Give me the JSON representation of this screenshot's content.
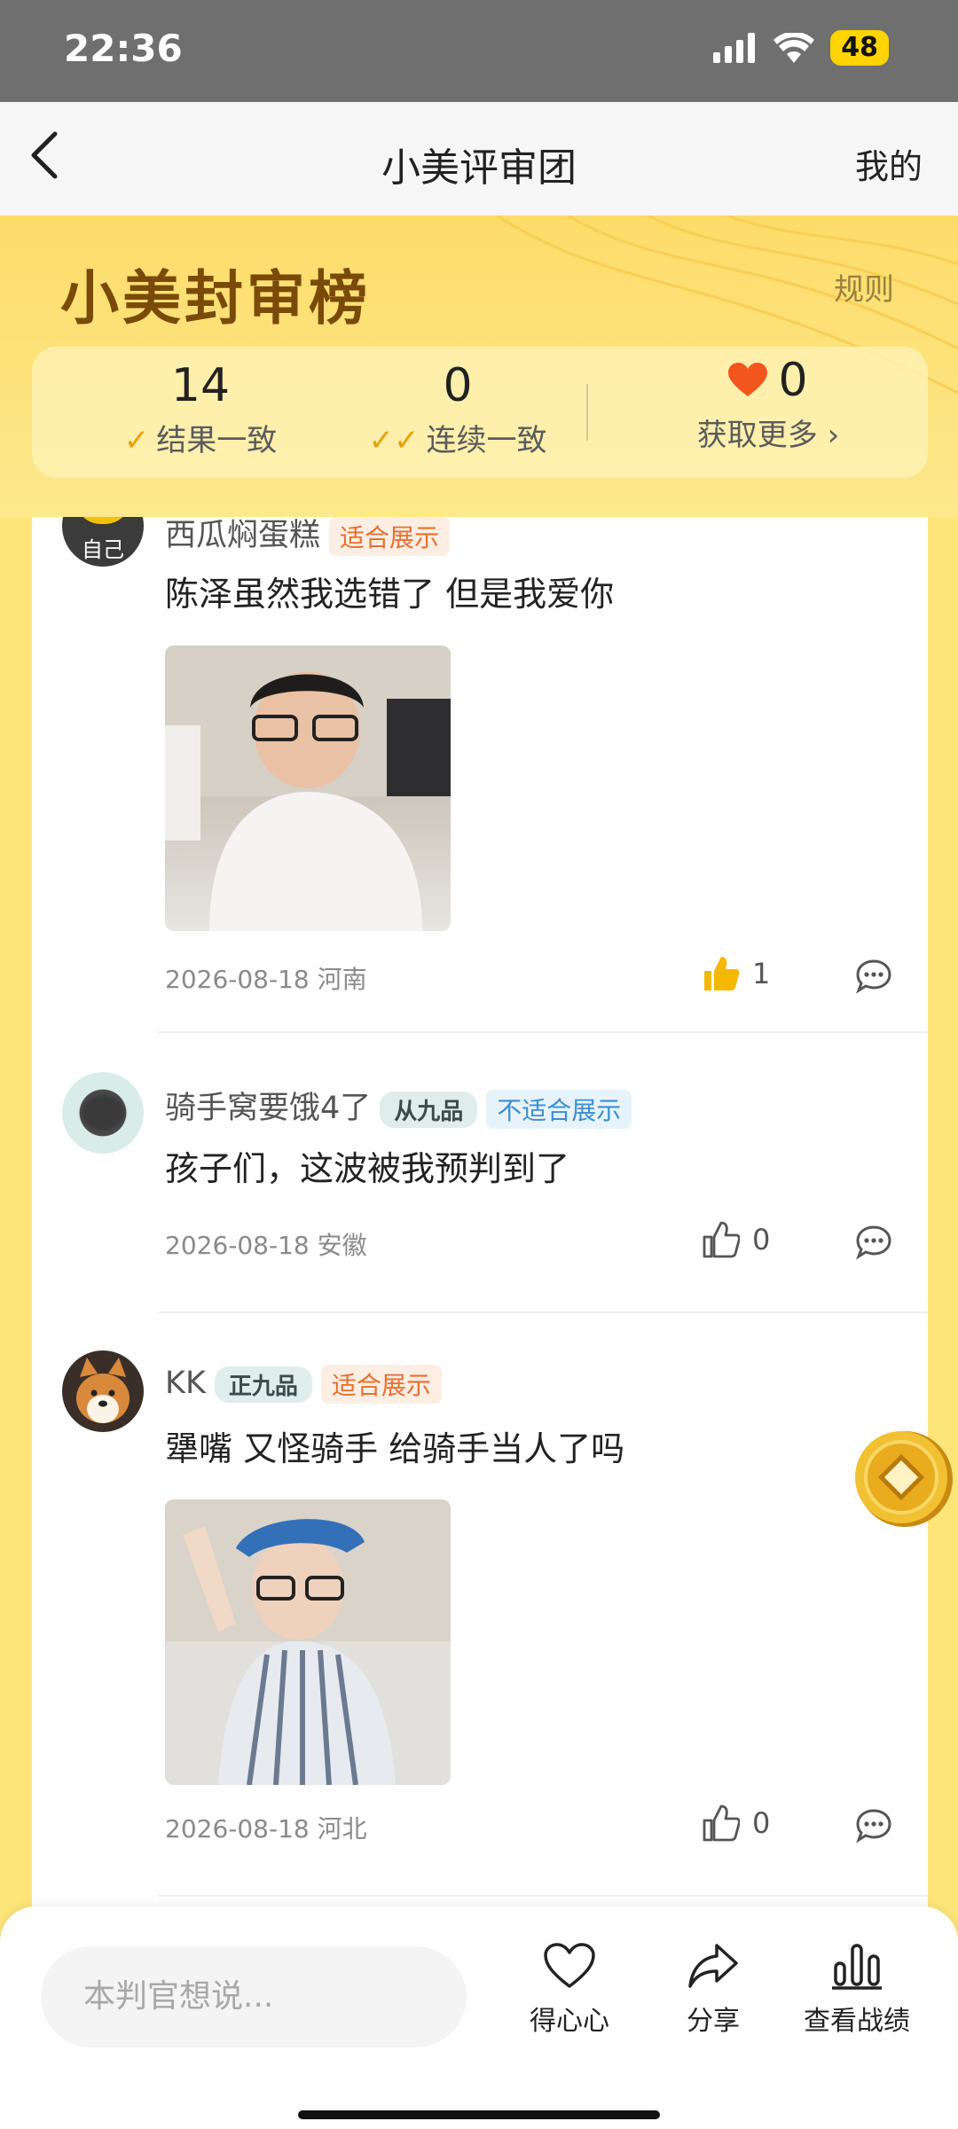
{
  "status_bar": {
    "time": "22:36",
    "battery": "48"
  },
  "nav": {
    "title": "小美评审团",
    "right_label": "我的"
  },
  "hero": {
    "title": "小美封审榜",
    "rules_label": "规则",
    "stats": [
      {
        "value": "14",
        "label": "结果一致"
      },
      {
        "value": "0",
        "label": "连续一致"
      },
      {
        "value": "0",
        "label": "获取更多"
      }
    ]
  },
  "comments": [
    {
      "username": "西瓜焖蛋糕",
      "avatar_badge": "自己",
      "tag": "适合展示",
      "text": "陈泽虽然我选错了 但是我爱你",
      "date": "2026-08-18",
      "region": "河南",
      "likes": "1",
      "liked": true
    },
    {
      "username": "骑手窝要饿4了",
      "rank": "从九品",
      "tag": "不适合展示",
      "text": "孩子们，这波被我预判到了",
      "date": "2026-08-18",
      "region": "安徽",
      "likes": "0",
      "liked": false
    },
    {
      "username": "KK",
      "rank": "正九品",
      "tag": "适合展示",
      "text": "犟嘴 又怪骑手 给骑手当人了吗",
      "date": "2026-08-18",
      "region": "河北",
      "likes": "0",
      "liked": false
    }
  ],
  "bottom_bar": {
    "input_placeholder": "本判官想说...",
    "buttons": [
      {
        "label": "得心心",
        "icon": "heart-outline-icon"
      },
      {
        "label": "分享",
        "icon": "share-arrow-icon"
      },
      {
        "label": "查看战绩",
        "icon": "bar-chart-icon"
      }
    ]
  },
  "colors": {
    "accent_yellow": "#fddc6a",
    "tag_ok": "#e86f2d",
    "tag_no": "#3a8fd1",
    "like_active": "#f5b800"
  }
}
